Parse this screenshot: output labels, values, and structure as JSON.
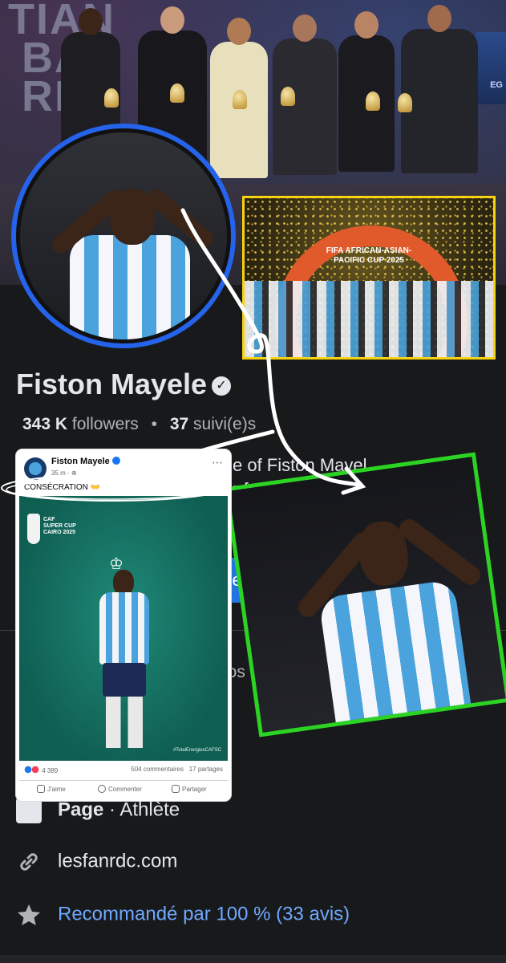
{
  "cover": {
    "background_text": "TIAN\n BA\n RD",
    "badge_text": "EG"
  },
  "yellow_photo": {
    "title": "FIFA AFRICAN-ASIAN-\nPACIFIC CUP 2025"
  },
  "profile": {
    "name": "Fiston Mayele",
    "verified_icon": "verified-badge-icon",
    "followers_count": "343 K",
    "followers_label": "followers",
    "separator": "•",
    "following_count": "37",
    "following_label": "suivi(e)s",
    "bio_line1": "e of Fiston Mayel",
    "bio_line2": "r fr",
    "follow_button_label": "(e)",
    "tab_label": "pos"
  },
  "info": {
    "page_label": "Page",
    "page_category": " · Athlète",
    "website": "lesfanrdc.com",
    "recommendation": "Recommandé par 100 % (33 avis)"
  },
  "post": {
    "author": "Fiston Mayele",
    "time": "35 m · ",
    "caption": "CONSÉCRATION 👐",
    "image_caf_text": "CAF\nSUPER CUP\nCAIRO 2025",
    "image_hashtag": "#TotalEnergiesCAFSC",
    "reactions_count": "4 389",
    "comments": "504 commentaires",
    "shares": "17 partages",
    "like_label": "J'aime",
    "comment_label": "Commenter",
    "share_label": "Partager"
  },
  "colors": {
    "background": "#18191a",
    "avatar_ring": "#2563eb",
    "yellow_frame": "#f5d311",
    "green_frame": "#2bd422",
    "link_blue": "#6fa8ff",
    "primary_button": "#2374e1"
  }
}
